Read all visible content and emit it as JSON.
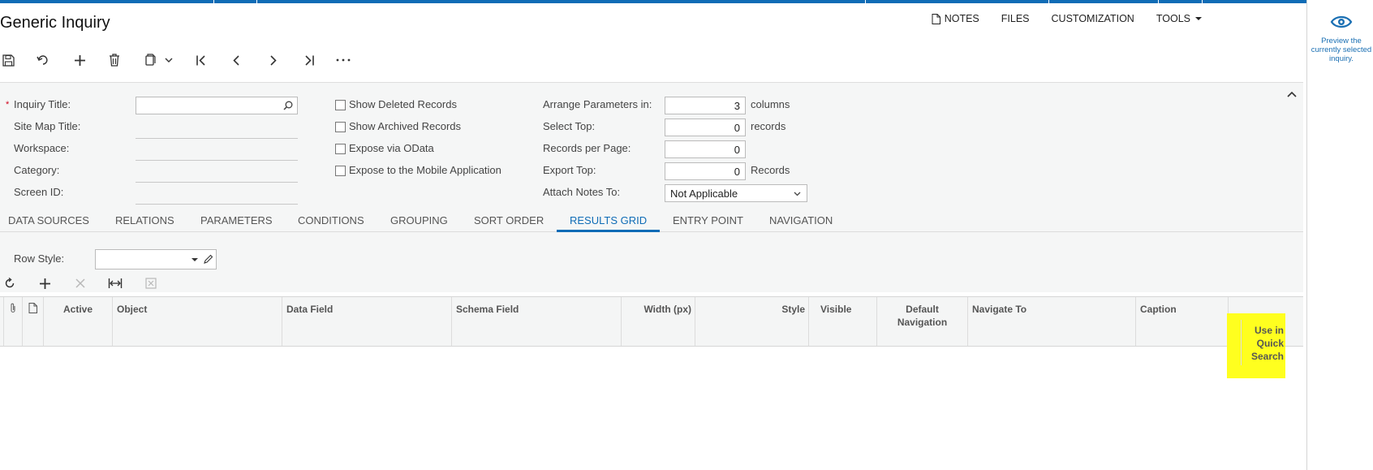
{
  "app": {
    "title": "Generic Inquiry"
  },
  "top_actions": {
    "notes": "NOTES",
    "files": "FILES",
    "customization": "CUSTOMIZATION",
    "tools": "TOOLS"
  },
  "right_panel": {
    "preview_text": "Preview the currently selected inquiry."
  },
  "toolbar": {
    "icons": [
      "save-icon",
      "undo-icon",
      "add-icon",
      "delete-icon",
      "copy-paste-icon",
      "first-record-icon",
      "previous-record-icon",
      "next-record-icon",
      "last-record-icon",
      "more-icon"
    ]
  },
  "form": {
    "inquiry_title": {
      "label": "Inquiry Title:",
      "required_mark": "*",
      "value": ""
    },
    "site_map_title": {
      "label": "Site Map Title:",
      "value": ""
    },
    "workspace": {
      "label": "Workspace:",
      "value": ""
    },
    "category": {
      "label": "Category:",
      "value": ""
    },
    "screen_id": {
      "label": "Screen ID:",
      "value": ""
    },
    "show_deleted": {
      "label": "Show Deleted Records",
      "checked": false
    },
    "show_archived": {
      "label": "Show Archived Records",
      "checked": false
    },
    "expose_odata": {
      "label": "Expose via OData",
      "checked": false
    },
    "expose_mobile": {
      "label": "Expose to the Mobile Application",
      "checked": false
    },
    "arrange_params": {
      "label": "Arrange Parameters in:",
      "value": "3",
      "unit": "columns"
    },
    "select_top": {
      "label": "Select Top:",
      "value": "0",
      "unit": "records"
    },
    "records_per_page": {
      "label": "Records per Page:",
      "value": "0"
    },
    "export_top": {
      "label": "Export Top:",
      "value": "0",
      "unit": "Records"
    },
    "attach_notes": {
      "label": "Attach Notes To:",
      "value": "Not Applicable"
    }
  },
  "tabs": [
    {
      "label": "DATA SOURCES"
    },
    {
      "label": "RELATIONS"
    },
    {
      "label": "PARAMETERS"
    },
    {
      "label": "CONDITIONS"
    },
    {
      "label": "GROUPING"
    },
    {
      "label": "SORT ORDER"
    },
    {
      "label": "RESULTS GRID",
      "active": true
    },
    {
      "label": "ENTRY POINT"
    },
    {
      "label": "NAVIGATION"
    }
  ],
  "results_grid": {
    "row_style_label": "Row Style:",
    "row_style_value": "",
    "columns": [
      {
        "label": "Active"
      },
      {
        "label": "Object"
      },
      {
        "label": "Data Field"
      },
      {
        "label": "Schema Field"
      },
      {
        "label": "Width (px)"
      },
      {
        "label": "Style"
      },
      {
        "label": "Visible"
      },
      {
        "label": "Default Navigation"
      },
      {
        "label": "Navigate To"
      },
      {
        "label": "Caption"
      },
      {
        "label": "Use in Quick Search",
        "highlighted": true
      }
    ],
    "rows": []
  },
  "colors": {
    "accent": "#0f6cb6",
    "highlight": "#ffff1f",
    "required": "#d0021b"
  }
}
